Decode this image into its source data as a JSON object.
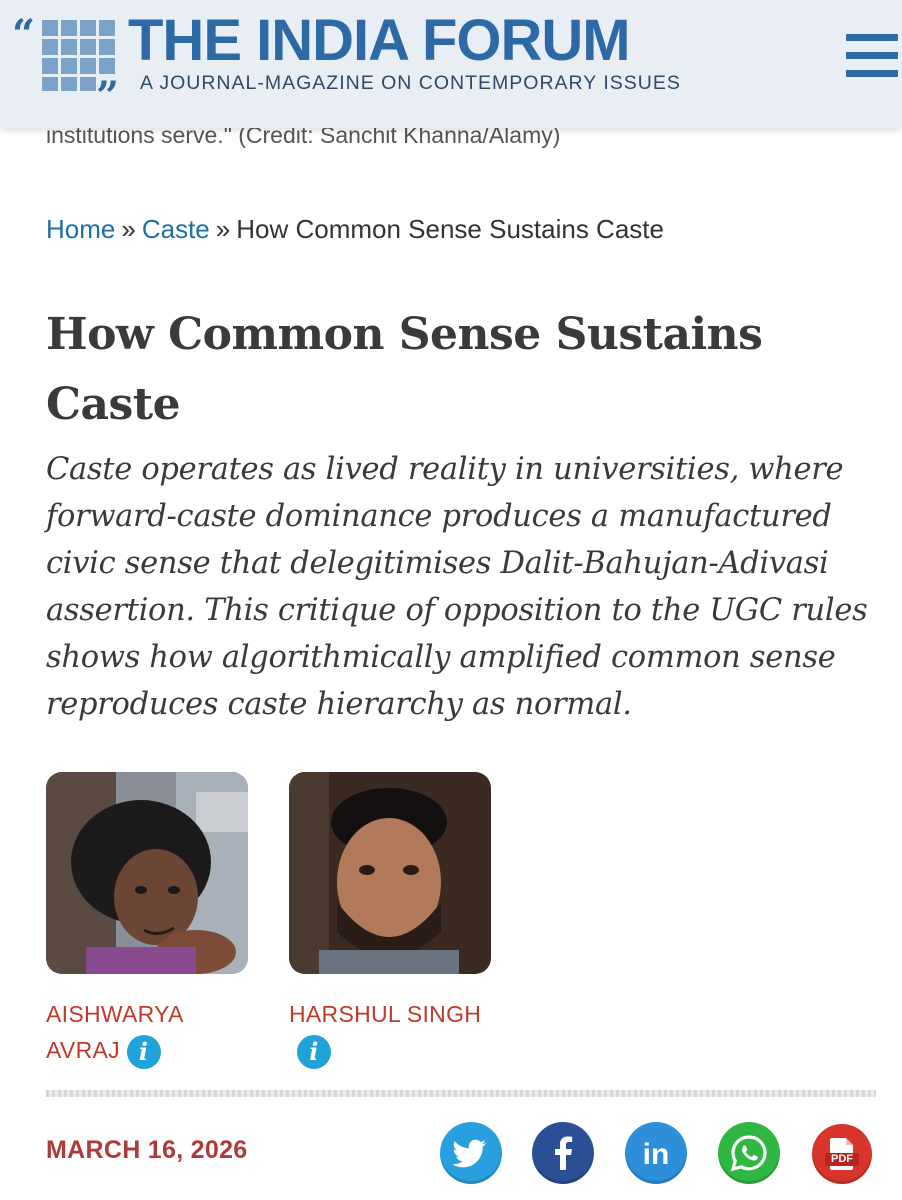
{
  "header": {
    "brand_title": "THE INDIA FORUM",
    "tagline": "A JOURNAL-MAGAZINE ON CONTEMPORARY ISSUES",
    "menu_icon": "hamburger-menu-icon"
  },
  "caption_remnant": "institutions serve.\" (Credit: Sanchit Khanna/Alamy)",
  "breadcrumb": {
    "home": "Home",
    "separator": "»",
    "category": "Caste",
    "current": "How Common Sense Sustains Caste"
  },
  "article": {
    "title": "How Common Sense Sustains Caste",
    "standfirst": "Caste operates as lived reality in universities, where forward-caste dominance produces a manufactured civic sense that delegitimises Dalit-Bahujan-Adivasi assertion. This critique of opposition to the UGC rules shows how algorithmically amplified common sense reproduces caste hierarchy as normal.",
    "date": "MARCH 16, 2026"
  },
  "authors": [
    {
      "name": "AISHWARYA AVRAJ",
      "info_icon": "info-icon"
    },
    {
      "name": "HARSHUL SINGH",
      "info_icon": "info-icon"
    }
  ],
  "share": {
    "twitter_icon": "twitter-icon",
    "facebook_icon": "facebook-icon",
    "linkedin_icon": "linkedin-icon",
    "whatsapp_icon": "whatsapp-icon",
    "pdf_label": "PDF"
  },
  "colors": {
    "brand_blue": "#2d6aa5",
    "link_blue": "#1d6fa5",
    "author_red": "#c0392b",
    "date_red": "#b03a3a",
    "info_blue": "#1fa3d8",
    "twitter": "#2a9fe0",
    "facebook": "#2b4f95",
    "linkedin": "#2d8fd9",
    "whatsapp": "#2eb843",
    "pdf": "#d8342c"
  }
}
